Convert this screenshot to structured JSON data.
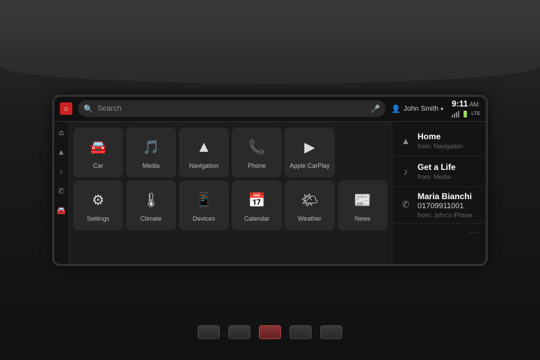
{
  "topbar": {
    "search_placeholder": "Search",
    "user_name": "John Smith",
    "time": "9:11",
    "am_pm": "AM",
    "lte": "LTE"
  },
  "sidebar": {
    "icons": [
      {
        "name": "navigation-icon",
        "symbol": "▲"
      },
      {
        "name": "music-note-icon",
        "symbol": "♪"
      },
      {
        "name": "phone-icon",
        "symbol": "✆"
      },
      {
        "name": "car-icon",
        "symbol": "🚗"
      }
    ]
  },
  "apps": {
    "row1": [
      {
        "id": "car",
        "label": "Car",
        "icon": "🚘"
      },
      {
        "id": "media",
        "label": "Media",
        "icon": "🎵"
      },
      {
        "id": "navigation",
        "label": "Navigation",
        "icon": "▲"
      },
      {
        "id": "phone",
        "label": "Phone",
        "icon": "📞"
      },
      {
        "id": "apple-carplay",
        "label": "Apple CarPlay",
        "icon": "▶"
      }
    ],
    "row2": [
      {
        "id": "settings",
        "label": "Settings",
        "icon": "⚙"
      },
      {
        "id": "climate",
        "label": "Climate",
        "icon": "🌡"
      },
      {
        "id": "devices",
        "label": "Devices",
        "icon": "📱"
      },
      {
        "id": "calendar",
        "label": "Calendar",
        "icon": "📅"
      },
      {
        "id": "weather",
        "label": "Weather",
        "icon": "🌤"
      },
      {
        "id": "news",
        "label": "News",
        "icon": "📰"
      }
    ]
  },
  "panel": {
    "items": [
      {
        "id": "home",
        "icon": "▲",
        "title": "Home",
        "subtitle": "from: Navigation",
        "type": "navigation"
      },
      {
        "id": "get-a-life",
        "icon": "♪",
        "title": "Get a Life",
        "subtitle": "from: Media",
        "type": "media"
      },
      {
        "id": "maria-bianchi",
        "icon": "✆",
        "title": "Maria Bianchi",
        "number": "01709911001",
        "subtitle": "from: John's iPhone",
        "type": "phone"
      }
    ],
    "more_icon": "···"
  }
}
